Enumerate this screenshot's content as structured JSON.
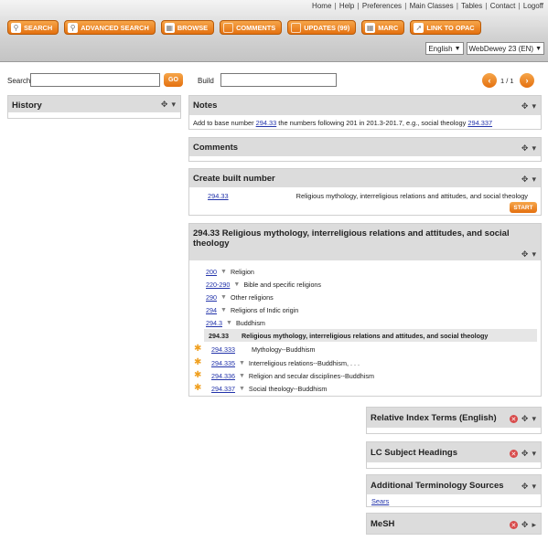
{
  "toplinks": [
    "Home",
    "Help",
    "Preferences",
    "Main Classes",
    "Tables",
    "Contact",
    "Logoff"
  ],
  "nav": [
    {
      "label": "SEARCH",
      "icon": "magnifier-icon"
    },
    {
      "label": "ADVANCED SEARCH",
      "icon": "magnifier-icon"
    },
    {
      "label": "BROWSE",
      "icon": "browse-icon"
    },
    {
      "label": "COMMENTS",
      "icon": "comments-icon"
    },
    {
      "label": "UPDATES (99)",
      "icon": "updates-icon"
    },
    {
      "label": "MARC",
      "icon": "marc-icon"
    },
    {
      "label": "LINK TO OPAC",
      "icon": "link-icon"
    }
  ],
  "language": "English",
  "edition": "WebDewey 23 (EN)",
  "search": {
    "label": "Search",
    "value": "",
    "go": "GO"
  },
  "build": {
    "label": "Build",
    "value": ""
  },
  "paging": "1 / 1",
  "history": {
    "title": "History"
  },
  "notes": {
    "title": "Notes",
    "text_before": "Add to base number ",
    "link1": "294.33",
    "text_mid": " the numbers following 201 in 201.3-201.7, e.g., social theology ",
    "link2": "294.337"
  },
  "comments": {
    "title": "Comments"
  },
  "create": {
    "title": "Create built number",
    "number": "294.33",
    "caption": "Religious mythology, interreligious relations and attitudes, and social theology",
    "start": "START"
  },
  "record": {
    "title_line1": "294.33 Religious mythology, interreligious relations and attitudes, and social",
    "title_line2": "theology",
    "hierarchy": [
      {
        "num": "200",
        "label": "Religion",
        "link": true
      },
      {
        "num": "220-290",
        "label": "Bible and specific religions",
        "link": true
      },
      {
        "num": "290",
        "label": "Other religions",
        "link": true
      },
      {
        "num": "294",
        "label": "Religions of Indic origin",
        "link": true
      },
      {
        "num": "294.3",
        "label": "Buddhism",
        "link": true
      },
      {
        "num": "294.33",
        "label": "Religious mythology, interreligious relations and attitudes, and social theology",
        "link": false
      }
    ],
    "children": [
      {
        "num": "294.333",
        "label": "Mythology--Buddhism",
        "expand": false
      },
      {
        "num": "294.335",
        "label": "Interreligious relations--Buddhism, . . .",
        "expand": true
      },
      {
        "num": "294.336",
        "label": "Religion and secular disciplines--Buddhism",
        "expand": true
      },
      {
        "num": "294.337",
        "label": "Social theology--Buddhism",
        "expand": true
      }
    ]
  },
  "relative_index": {
    "title": "Relative Index Terms (English)"
  },
  "lcsh": {
    "title": "LC Subject Headings"
  },
  "additional": {
    "title": "Additional Terminology Sources",
    "link": "Sears"
  },
  "mesh": {
    "title": "MeSH"
  },
  "colors": {
    "accent": "#e4700f",
    "panel_header": "#dcdcdc",
    "link": "#2233aa"
  }
}
